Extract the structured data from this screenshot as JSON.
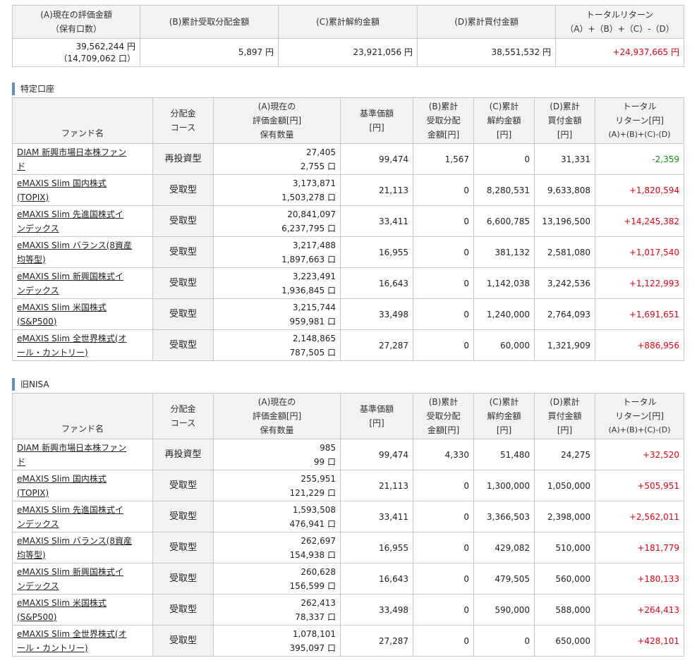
{
  "summary": {
    "headers": {
      "a_line1": "(A)現在の評価金額",
      "a_line2": "（保有口数）",
      "b": "(B)累計受取分配金額",
      "c": "(C)累計解約金額",
      "d": "(D)累計買付金額",
      "t_line1": "トータルリターン",
      "t_line2": "（A）+（B）+（C）-（D）"
    },
    "values": {
      "a_amount": "39,562,244 円",
      "a_units": "（14,709,062 口）",
      "b": "5,897 円",
      "c": "23,921,056 円",
      "d": "38,551,532 円",
      "total": "+24,937,665 円"
    }
  },
  "columns": {
    "fund_name": "ファンド名",
    "course_l1": "分配金",
    "course_l2": "コース",
    "a_l1": "(A)現在の",
    "a_l2": "評価金額[円]",
    "a_l3": "保有数量",
    "base_l1": "基準価額",
    "base_l2": "[円]",
    "b_l1": "(B)累計",
    "b_l2": "受取分配",
    "b_l3": "金額[円]",
    "c_l1": "(C)累計",
    "c_l2": "解約金額",
    "c_l3": "[円]",
    "d_l1": "(D)累計",
    "d_l2": "買付金額",
    "d_l3": "[円]",
    "t_l1": "トータル",
    "t_l2": "リターン[円]",
    "t_l3": "(A)+(B)+(C)-(D)"
  },
  "sections": [
    {
      "title": "特定口座",
      "rows": [
        {
          "name_l1": "DIAM 新興市場日本株ファン",
          "name_l2": "ド",
          "course": "再投資型",
          "amount": "27,405",
          "units": "2,755 口",
          "base": "99,474",
          "b": "1,567",
          "c": "0",
          "d": "31,331",
          "total": "-2,359",
          "sign": "neg"
        },
        {
          "name_l1": "eMAXIS Slim 国内株式",
          "name_l2": "(TOPIX)",
          "course": "受取型",
          "amount": "3,173,871",
          "units": "1,503,278 口",
          "base": "21,113",
          "b": "0",
          "c": "8,280,531",
          "d": "9,633,808",
          "total": "+1,820,594",
          "sign": "pos"
        },
        {
          "name_l1": "eMAXIS Slim 先進国株式イ",
          "name_l2": "ンデックス",
          "course": "受取型",
          "amount": "20,841,097",
          "units": "6,237,795 口",
          "base": "33,411",
          "b": "0",
          "c": "6,600,785",
          "d": "13,196,500",
          "total": "+14,245,382",
          "sign": "pos"
        },
        {
          "name_l1": "eMAXIS Slim バランス(8資産",
          "name_l2": "均等型)",
          "course": "受取型",
          "amount": "3,217,488",
          "units": "1,897,663 口",
          "base": "16,955",
          "b": "0",
          "c": "381,132",
          "d": "2,581,080",
          "total": "+1,017,540",
          "sign": "pos"
        },
        {
          "name_l1": "eMAXIS Slim 新興国株式イ",
          "name_l2": "ンデックス",
          "course": "受取型",
          "amount": "3,223,491",
          "units": "1,936,845 口",
          "base": "16,643",
          "b": "0",
          "c": "1,142,038",
          "d": "3,242,536",
          "total": "+1,122,993",
          "sign": "pos"
        },
        {
          "name_l1": "eMAXIS Slim 米国株式",
          "name_l2": "(S&P500)",
          "course": "受取型",
          "amount": "3,215,744",
          "units": "959,981 口",
          "base": "33,498",
          "b": "0",
          "c": "1,240,000",
          "d": "2,764,093",
          "total": "+1,691,651",
          "sign": "pos"
        },
        {
          "name_l1": "eMAXIS Slim 全世界株式(オ",
          "name_l2": "ール・カントリー)",
          "course": "受取型",
          "amount": "2,148,865",
          "units": "787,505 口",
          "base": "27,287",
          "b": "0",
          "c": "60,000",
          "d": "1,321,909",
          "total": "+886,956",
          "sign": "pos"
        }
      ]
    },
    {
      "title": "旧NISA",
      "rows": [
        {
          "name_l1": "DIAM 新興市場日本株ファン",
          "name_l2": "ド",
          "course": "再投資型",
          "amount": "985",
          "units": "99 口",
          "base": "99,474",
          "b": "4,330",
          "c": "51,480",
          "d": "24,275",
          "total": "+32,520",
          "sign": "pos"
        },
        {
          "name_l1": "eMAXIS Slim 国内株式",
          "name_l2": "(TOPIX)",
          "course": "受取型",
          "amount": "255,951",
          "units": "121,229 口",
          "base": "21,113",
          "b": "0",
          "c": "1,300,000",
          "d": "1,050,000",
          "total": "+505,951",
          "sign": "pos"
        },
        {
          "name_l1": "eMAXIS Slim 先進国株式イ",
          "name_l2": "ンデックス",
          "course": "受取型",
          "amount": "1,593,508",
          "units": "476,941 口",
          "base": "33,411",
          "b": "0",
          "c": "3,366,503",
          "d": "2,398,000",
          "total": "+2,562,011",
          "sign": "pos"
        },
        {
          "name_l1": "eMAXIS Slim バランス(8資産",
          "name_l2": "均等型)",
          "course": "受取型",
          "amount": "262,697",
          "units": "154,938 口",
          "base": "16,955",
          "b": "0",
          "c": "429,082",
          "d": "510,000",
          "total": "+181,779",
          "sign": "pos"
        },
        {
          "name_l1": "eMAXIS Slim 新興国株式イ",
          "name_l2": "ンデックス",
          "course": "受取型",
          "amount": "260,628",
          "units": "156,599 口",
          "base": "16,643",
          "b": "0",
          "c": "479,505",
          "d": "560,000",
          "total": "+180,133",
          "sign": "pos"
        },
        {
          "name_l1": "eMAXIS Slim 米国株式",
          "name_l2": "(S&P500)",
          "course": "受取型",
          "amount": "262,413",
          "units": "78,337 口",
          "base": "33,498",
          "b": "0",
          "c": "590,000",
          "d": "588,000",
          "total": "+264,413",
          "sign": "pos"
        },
        {
          "name_l1": "eMAXIS Slim 全世界株式(オ",
          "name_l2": "ール・カントリー)",
          "course": "受取型",
          "amount": "1,078,101",
          "units": "395,097 口",
          "base": "27,287",
          "b": "0",
          "c": "0",
          "d": "650,000",
          "total": "+428,101",
          "sign": "pos"
        }
      ]
    }
  ]
}
